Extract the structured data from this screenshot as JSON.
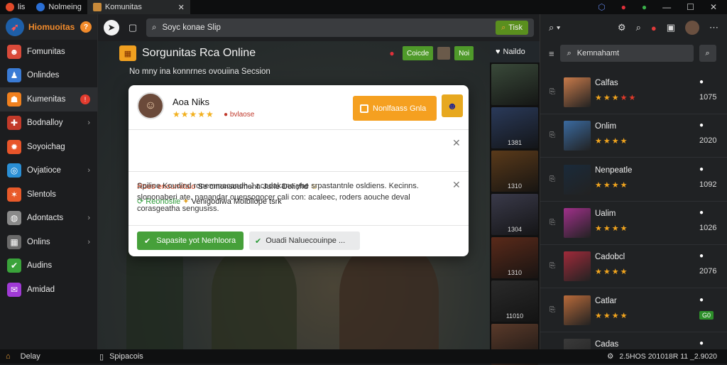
{
  "titlebar": {
    "tabs": [
      {
        "label": "lis",
        "icon": "red-circle-icon"
      },
      {
        "label": "Nolmeing",
        "icon": "round-logo-icon"
      },
      {
        "label": "Komunitas",
        "icon": "game-icon",
        "close": "✕"
      }
    ]
  },
  "sidebar": {
    "brand": {
      "label": "Hiomuoitas",
      "badge": "?"
    },
    "items": [
      {
        "label": "Fomunitas",
        "icon": "people-icon",
        "color": "#d94a3a"
      },
      {
        "label": "Onlindes",
        "icon": "person-icon",
        "color": "#3a7bd5"
      },
      {
        "label": "Kumenitas",
        "icon": "community-icon",
        "color": "#f0801e",
        "alert": "!"
      },
      {
        "label": "Bodnalloy",
        "icon": "game-controller-icon",
        "color": "#c23a2a",
        "chevron": "›"
      },
      {
        "label": "Soyoichag",
        "icon": "flame-icon",
        "color": "#e8552a"
      },
      {
        "label": "Ovjatioce",
        "icon": "globe-icon",
        "color": "#2a8fd5",
        "chevron": "›"
      },
      {
        "label": "Slentols",
        "icon": "sparkle-icon",
        "color": "#e85a2a"
      },
      {
        "label": "Adontacts",
        "icon": "contacts-icon",
        "color": "#8a8a8a",
        "chevron": "›"
      },
      {
        "label": "Onlins",
        "icon": "grid-icon",
        "color": "#6a6a6a",
        "chevron": "›"
      },
      {
        "label": "Audins",
        "icon": "check-icon",
        "color": "#3aa33a"
      },
      {
        "label": "Amidad",
        "icon": "mail-icon",
        "color": "#a03ad5"
      }
    ]
  },
  "toolbar": {
    "search_placeholder": "Soyc konae Slip",
    "search_button": "Tisk"
  },
  "main": {
    "title": "Sorgunitas Rca Online",
    "subtitle": "No mny ina konnrnes ovouiina Secsion",
    "header_button_1": "Coicde",
    "header_button_2": "Noi",
    "mailbox_label": "Naildo"
  },
  "modal": {
    "user_name": "Aoa Niks",
    "rating_stars": "★★★★★",
    "user_flag": "bvlaose",
    "primary_button": "Nonlfaass Gnla",
    "line1_red": "Roes enoumitaio",
    "line1_rest": "Se cmonsoument. Jurle Dolichd",
    "line2_green": "Reonoslie",
    "line2_rest": "Venigodiwa Molbliope tsrk",
    "description": "Spiline Koudind ronemmacandh J acodakane yhe srpastantnle osldiens. Kecinns. slononaberi ate. nanandar ouensogocer cali con: acaleec, roders aouche deval corasgeatha sengusiss.",
    "button_accept": "Sapasite yot Nerhloora",
    "button_secondary": "Ouadi Naluecouinpe ..."
  },
  "strip": {
    "thumbs": [
      {
        "label": "",
        "color": "#3a4a3a"
      },
      {
        "label": "1381",
        "color": "#2a3a5a"
      },
      {
        "label": "1310",
        "color": "#5a3a1a"
      },
      {
        "label": "1304",
        "color": "#3a3a4a"
      },
      {
        "label": "1310",
        "color": "#5a2a1a"
      },
      {
        "label": "11010",
        "color": "#2a2a2a"
      },
      {
        "label": "",
        "color": "#5a3a2a"
      }
    ]
  },
  "right": {
    "search_placeholder": "Kemnahamt",
    "items": [
      {
        "name": "Calfas",
        "stars": "★★★",
        "red": "★★",
        "num": "1075",
        "color": "#c87a4a"
      },
      {
        "name": "Onlim",
        "stars": "★★★★",
        "red": "",
        "num": "2020",
        "color": "#3a6aa0"
      },
      {
        "name": "Nenpeatle",
        "stars": "★★★★",
        "red": "",
        "num": "1092",
        "color": "#1a2a3a"
      },
      {
        "name": "Ualim",
        "stars": "★★★★",
        "red": "",
        "num": "1026",
        "color": "#a0308a"
      },
      {
        "name": "Cadobcl",
        "stars": "★★★★",
        "red": "",
        "num": "2076",
        "color": "#a02a3a"
      },
      {
        "name": "Catlar",
        "stars": "★★★★",
        "red": "",
        "num": "G0",
        "color": "#b86a3a"
      },
      {
        "name": "Cadas",
        "stars": "",
        "red": "",
        "num": "",
        "color": "#3a3a3a"
      }
    ]
  },
  "statusbar": {
    "left": "Delay",
    "middle": "Spipacois",
    "right": "2.5HOS 201018R 11 _2.9020"
  }
}
